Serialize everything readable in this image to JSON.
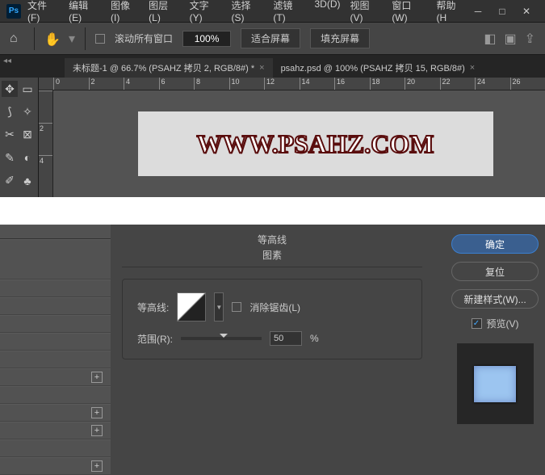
{
  "menu": {
    "file": "文件(F)",
    "edit": "编辑(E)",
    "image": "图像(I)",
    "layer": "图层(L)",
    "type": "文字(Y)",
    "select": "选择(S)",
    "filter": "滤镜(T)",
    "threeD": "3D(D)",
    "view": "视图(V)",
    "window": "窗口(W)",
    "help": "帮助(H"
  },
  "options": {
    "scrollAll": "滚动所有窗口",
    "zoom": "100%",
    "fitScreen": "适合屏幕",
    "fillScreen": "填充屏幕"
  },
  "tabs": {
    "tab1": "未标题-1 @ 66.7% (PSAHZ 拷贝 2, RGB/8#) *",
    "tab2": "psahz.psd @ 100% (PSAHZ 拷贝 15, RGB/8#)"
  },
  "ruler": {
    "t0": "0",
    "t2": "2",
    "t4": "4",
    "t6": "6",
    "t8": "8",
    "t10": "10",
    "t12": "12",
    "t14": "14",
    "t16": "16",
    "t18": "18",
    "t20": "20",
    "t22": "22",
    "t24": "24",
    "t26": "26",
    "v2": "2",
    "v4": "4"
  },
  "canvas": {
    "text": "WWW.PSAHZ.COM"
  },
  "dialog": {
    "sectionTitle": "等高线",
    "sectionSub": "图素",
    "contourLabel": "等高线:",
    "antiAlias": "消除锯齿(L)",
    "rangeLabel": "范围(R):",
    "rangeValue": "50",
    "rangeUnit": "%",
    "ok": "确定",
    "reset": "复位",
    "newStyle": "新建样式(W)...",
    "preview": "预览(V)"
  }
}
